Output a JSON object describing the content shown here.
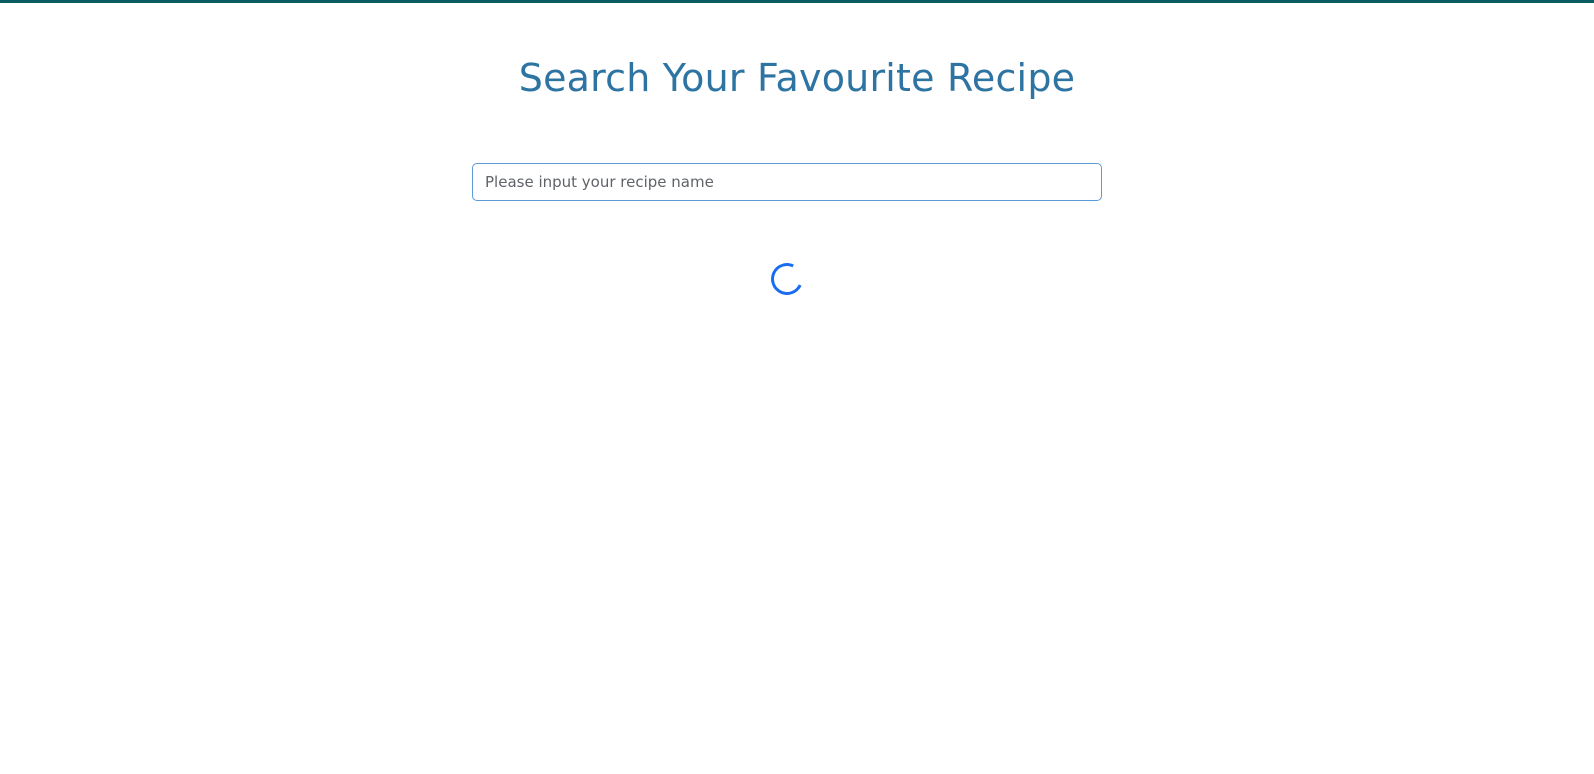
{
  "page": {
    "heading": "Search Your Favourite Recipe",
    "search": {
      "placeholder": "Please input your recipe name",
      "value": ""
    },
    "loading_indicator": "spinner-icon"
  },
  "colors": {
    "top_border": "#0b5c62",
    "heading": "#2e74a3",
    "input_border": "#5a9ad6",
    "spinner": "#1a6cf0",
    "background": "#ffffff"
  }
}
